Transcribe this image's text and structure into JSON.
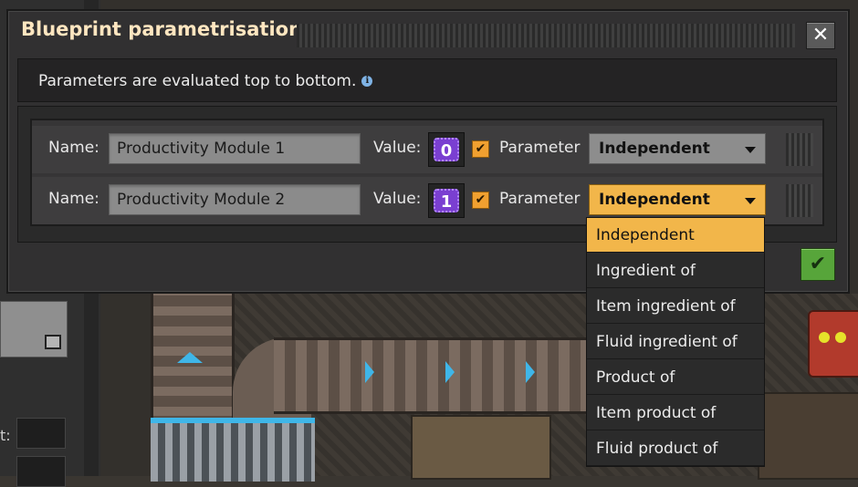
{
  "dialog": {
    "title": "Blueprint parametrisation",
    "info_text": "Parameters are evaluated top to bottom.",
    "info_icon": "i"
  },
  "rows": [
    {
      "name_label": "Name:",
      "name_value": "Productivity Module 1",
      "value_label": "Value:",
      "value": "0",
      "checked": true,
      "param_label": "Parameter",
      "dropdown_value": "Independent",
      "dropdown_open": false
    },
    {
      "name_label": "Name:",
      "name_value": "Productivity Module 2",
      "value_label": "Value:",
      "value": "1",
      "checked": true,
      "param_label": "Parameter",
      "dropdown_value": "Independent",
      "dropdown_open": true
    }
  ],
  "dropdown_options": [
    "Independent",
    "Ingredient of",
    "Item ingredient of",
    "Fluid ingredient of",
    "Product of",
    "Item product of",
    "Fluid product of"
  ],
  "selected_option": "Independent",
  "controls": {
    "close_glyph": "✕",
    "confirm_glyph": "✔",
    "check_glyph": "✔"
  },
  "background": {
    "side_label": "t:"
  },
  "colors": {
    "accent": "#f2b64a",
    "confirm": "#57a53a",
    "value_badge": "#7a3fd1",
    "title": "#ffe6c0"
  }
}
